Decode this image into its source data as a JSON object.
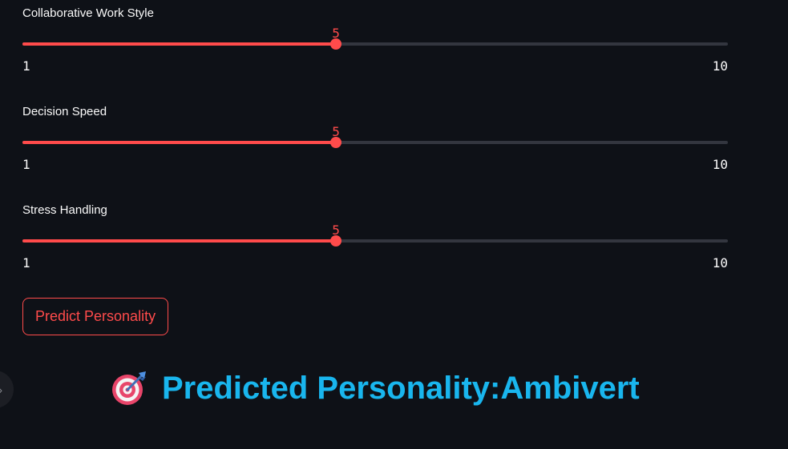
{
  "sliders": [
    {
      "label": "Collaborative Work Style",
      "value": 5,
      "value_text": "5",
      "min": 1,
      "max": 10,
      "min_text": "1",
      "max_text": "10"
    },
    {
      "label": "Decision Speed",
      "value": 5,
      "value_text": "5",
      "min": 1,
      "max": 10,
      "min_text": "1",
      "max_text": "10"
    },
    {
      "label": "Stress Handling",
      "value": 5,
      "value_text": "5",
      "min": 1,
      "max": 10,
      "min_text": "1",
      "max_text": "10"
    }
  ],
  "predict_button": {
    "label": "Predict Personality"
  },
  "result": {
    "icon": "target-dart-icon",
    "text": "Predicted Personality:Ambivert"
  },
  "colors": {
    "accent": "#ff4b4b",
    "track": "#33363f",
    "background": "#0e1117",
    "result_text": "#19b6ee"
  }
}
